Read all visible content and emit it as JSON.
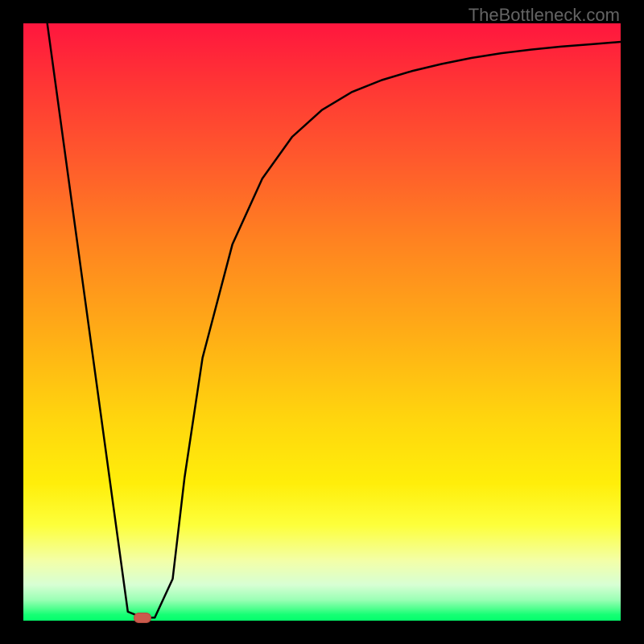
{
  "watermark": "TheBottleneck.com",
  "chart_data": {
    "type": "line",
    "title": "",
    "xlabel": "",
    "ylabel": "",
    "xlim": [
      0,
      100
    ],
    "ylim": [
      0,
      100
    ],
    "gradient_stops": [
      {
        "pos": 0,
        "color": "#ff163e"
      },
      {
        "pos": 10,
        "color": "#ff3535"
      },
      {
        "pos": 23,
        "color": "#ff5a2c"
      },
      {
        "pos": 37,
        "color": "#ff8420"
      },
      {
        "pos": 52,
        "color": "#ffad16"
      },
      {
        "pos": 66,
        "color": "#ffd50e"
      },
      {
        "pos": 77,
        "color": "#ffee0a"
      },
      {
        "pos": 84,
        "color": "#fdff3b"
      },
      {
        "pos": 90,
        "color": "#f3ffa8"
      },
      {
        "pos": 94,
        "color": "#d7ffd4"
      },
      {
        "pos": 96.5,
        "color": "#9bffb5"
      },
      {
        "pos": 98,
        "color": "#4eff8e"
      },
      {
        "pos": 99,
        "color": "#15ff74"
      },
      {
        "pos": 100,
        "color": "#04ff6c"
      }
    ],
    "series": [
      {
        "name": "left-slope",
        "x": [
          4,
          17.5,
          20
        ],
        "y": [
          100,
          1.5,
          0.5
        ]
      },
      {
        "name": "right-curve",
        "x": [
          22,
          25,
          27,
          30,
          35,
          40,
          45,
          50,
          55,
          60,
          65,
          70,
          75,
          80,
          85,
          90,
          95,
          100
        ],
        "y": [
          0.5,
          7,
          24,
          44,
          63,
          74,
          81,
          85.5,
          88.5,
          90.5,
          92,
          93.2,
          94.2,
          95,
          95.6,
          96.1,
          96.5,
          96.9
        ]
      }
    ],
    "marker": {
      "x": 20,
      "y": 0.6,
      "color": "#cb5b4c"
    }
  }
}
